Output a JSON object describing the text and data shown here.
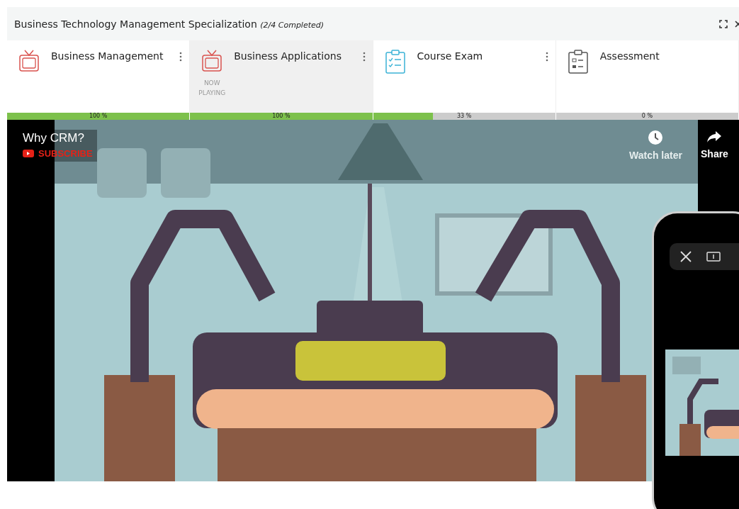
{
  "window": {
    "title": "Business Technology Management Specialization",
    "subtitle": "(2/4 Completed)"
  },
  "tabs": [
    {
      "kind": "video",
      "label": "Business Management",
      "selected": false,
      "progress": "100 %",
      "level": 1
    },
    {
      "kind": "video",
      "label": "Business Applications",
      "selected": true,
      "status": "NOW PLAYING",
      "progress": "100 %",
      "level": 1
    },
    {
      "kind": "exam",
      "label": "Course Exam",
      "selected": false,
      "progress": "33 %",
      "level": 0.33
    },
    {
      "kind": "assessment",
      "label": "Assessment",
      "selected": false,
      "progress": "0 %",
      "level": 0
    }
  ],
  "video": {
    "title": "Why CRM?",
    "subscribe": "SUBSCRIBE",
    "watch_later": "Watch later",
    "share": "Share"
  }
}
